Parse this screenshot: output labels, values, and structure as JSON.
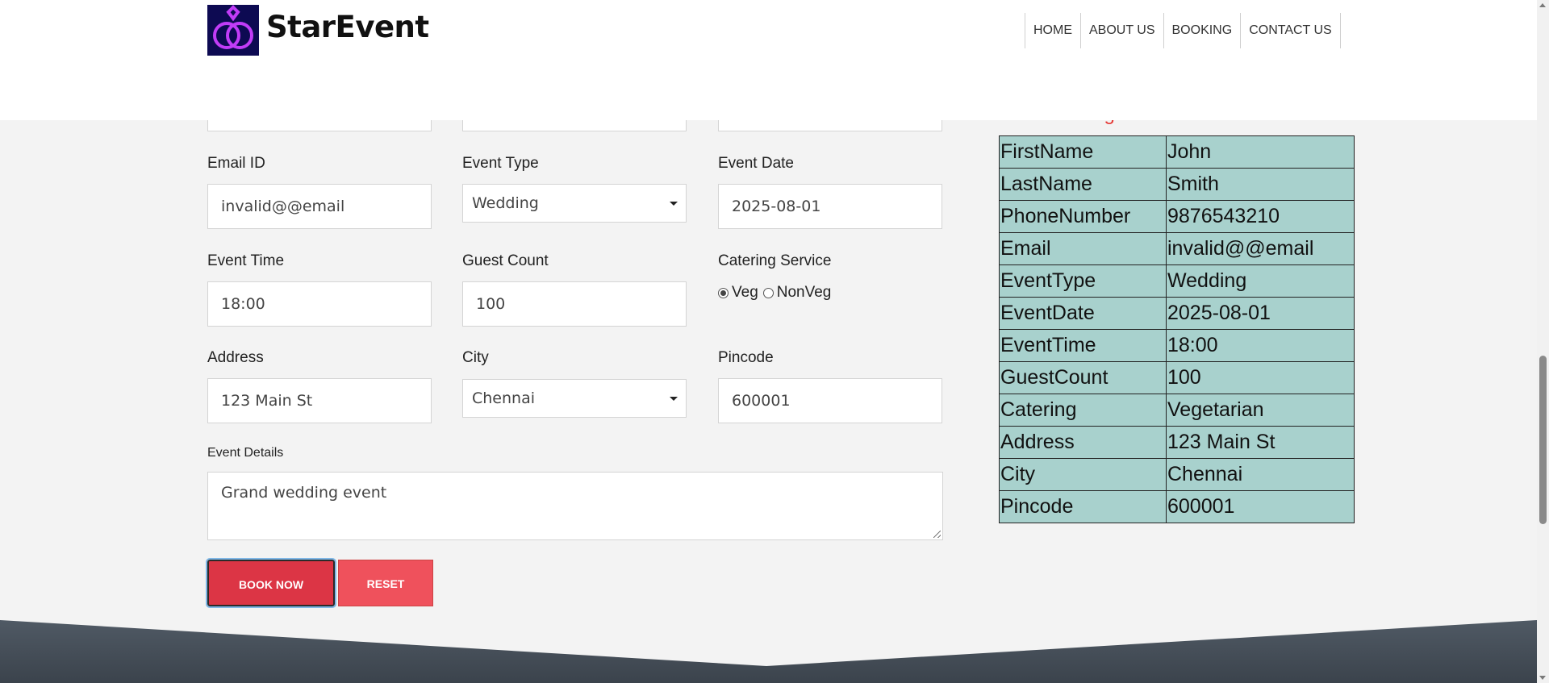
{
  "header": {
    "brand": "StarEvent",
    "logo_icon": "rings-icon",
    "nav": [
      "HOME",
      "ABOUT US",
      "BOOKING",
      "CONTACT US"
    ]
  },
  "form": {
    "email_label": "Email ID",
    "email_value": "invalid@@email",
    "event_type_label": "Event Type",
    "event_type_value": "Wedding",
    "event_date_label": "Event Date",
    "event_date_value": "2025-08-01",
    "event_time_label": "Event Time",
    "event_time_value": "18:00",
    "guest_count_label": "Guest Count",
    "guest_count_value": "100",
    "catering_label": "Catering Service",
    "catering_options": [
      "Veg",
      "NonVeg"
    ],
    "catering_selected": "Veg",
    "address_label": "Address",
    "address_value": "123 Main St",
    "city_label": "City",
    "city_value": "Chennai",
    "pincode_label": "Pincode",
    "pincode_value": "600001",
    "details_label": "Event Details",
    "details_value": "Grand wedding event",
    "book_button": "BOOK NOW",
    "reset_button": "RESET"
  },
  "confirmation": {
    "message": "Your Booking has been Confirmed !",
    "color": "#e53935",
    "rows": [
      {
        "key": "FirstName",
        "value": "John"
      },
      {
        "key": "LastName",
        "value": "Smith"
      },
      {
        "key": "PhoneNumber",
        "value": "9876543210"
      },
      {
        "key": "Email",
        "value": "invalid@@email"
      },
      {
        "key": "EventType",
        "value": "Wedding"
      },
      {
        "key": "EventDate",
        "value": "2025-08-01"
      },
      {
        "key": "EventTime",
        "value": "18:00"
      },
      {
        "key": "GuestCount",
        "value": "100"
      },
      {
        "key": "Catering",
        "value": "Vegetarian"
      },
      {
        "key": "Address",
        "value": "123 Main St"
      },
      {
        "key": "City",
        "value": "Chennai"
      },
      {
        "key": "Pincode",
        "value": "600001"
      }
    ]
  },
  "colors": {
    "primary_button": "#dc3545",
    "reset_button": "#ef515c",
    "table_bg": "#a8d1cd",
    "logo_bg": "#0d0a52",
    "logo_accent": "#c13cf7"
  }
}
